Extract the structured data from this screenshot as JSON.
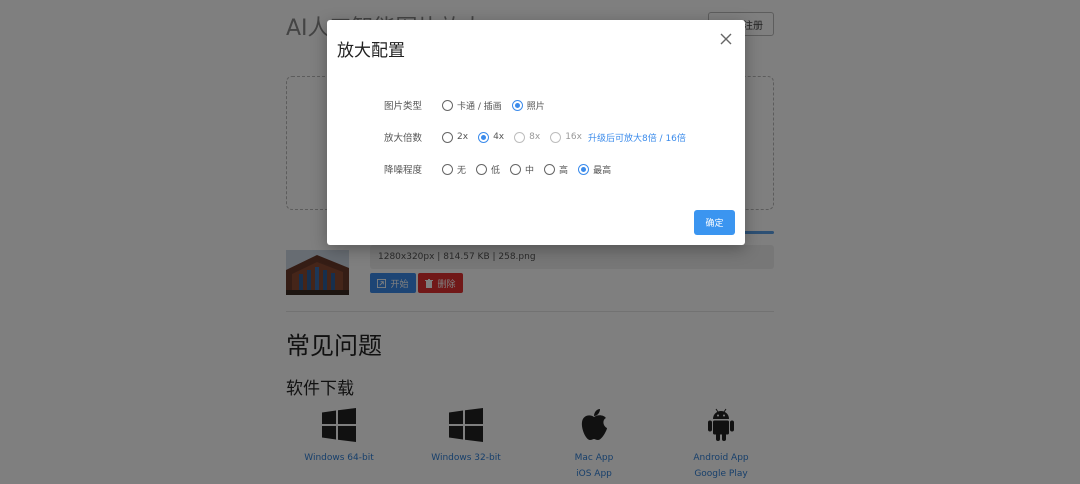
{
  "header": {
    "app_title": "AI人工智能图片放大",
    "login_label": "登录/注册"
  },
  "upload": {
    "file_info": "1280x320px | 814.57 KB | 258.png",
    "start_label": "开始",
    "delete_label": "删除",
    "progress_fraction": 0.17
  },
  "faq": {
    "title": "常见问题"
  },
  "downloads": {
    "title": "软件下载",
    "items": [
      {
        "icon": "windows-icon",
        "links": [
          "Windows 64-bit"
        ]
      },
      {
        "icon": "windows-icon",
        "links": [
          "Windows 32-bit"
        ]
      },
      {
        "icon": "apple-icon",
        "links": [
          "Mac App",
          "iOS App"
        ]
      },
      {
        "icon": "android-icon",
        "links": [
          "Android App",
          "Google Play"
        ]
      }
    ]
  },
  "modal": {
    "title": "放大配置",
    "close_icon": "close-icon",
    "image_type": {
      "label": "图片类型",
      "options": [
        "卡通 / 插画",
        "照片"
      ],
      "selected": "照片"
    },
    "scale": {
      "label": "放大倍数",
      "options": [
        "2x",
        "4x",
        "8x",
        "16x"
      ],
      "selected": "4x",
      "disabled": [
        "8x",
        "16x"
      ],
      "upgrade_note": "升级后可放大8倍 / 16倍"
    },
    "denoise": {
      "label": "降噪程度",
      "options": [
        "无",
        "低",
        "中",
        "高",
        "最高"
      ],
      "selected": "最高"
    },
    "confirm_label": "确定"
  },
  "colors": {
    "accent": "#3b8beb",
    "danger": "#e23131",
    "link": "#2f7fd6"
  }
}
